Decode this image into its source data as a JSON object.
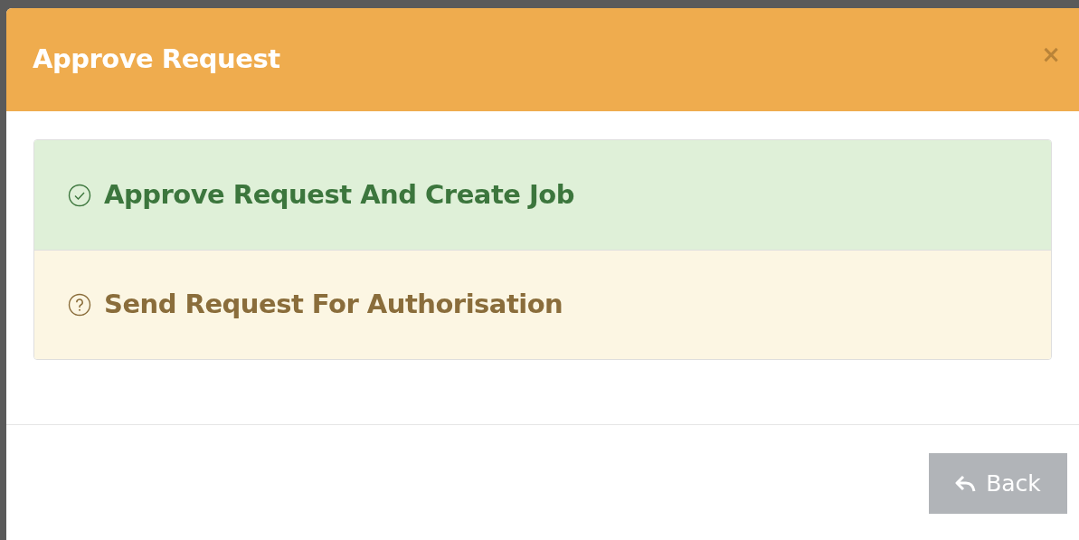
{
  "dialog": {
    "title": "Approve Request",
    "close": "×",
    "options": [
      {
        "kind": "success",
        "label": "Approve Request And Create Job"
      },
      {
        "kind": "warning",
        "label": "Send Request For Authorisation"
      }
    ],
    "buttons": [
      {
        "label": "Back"
      }
    ]
  }
}
